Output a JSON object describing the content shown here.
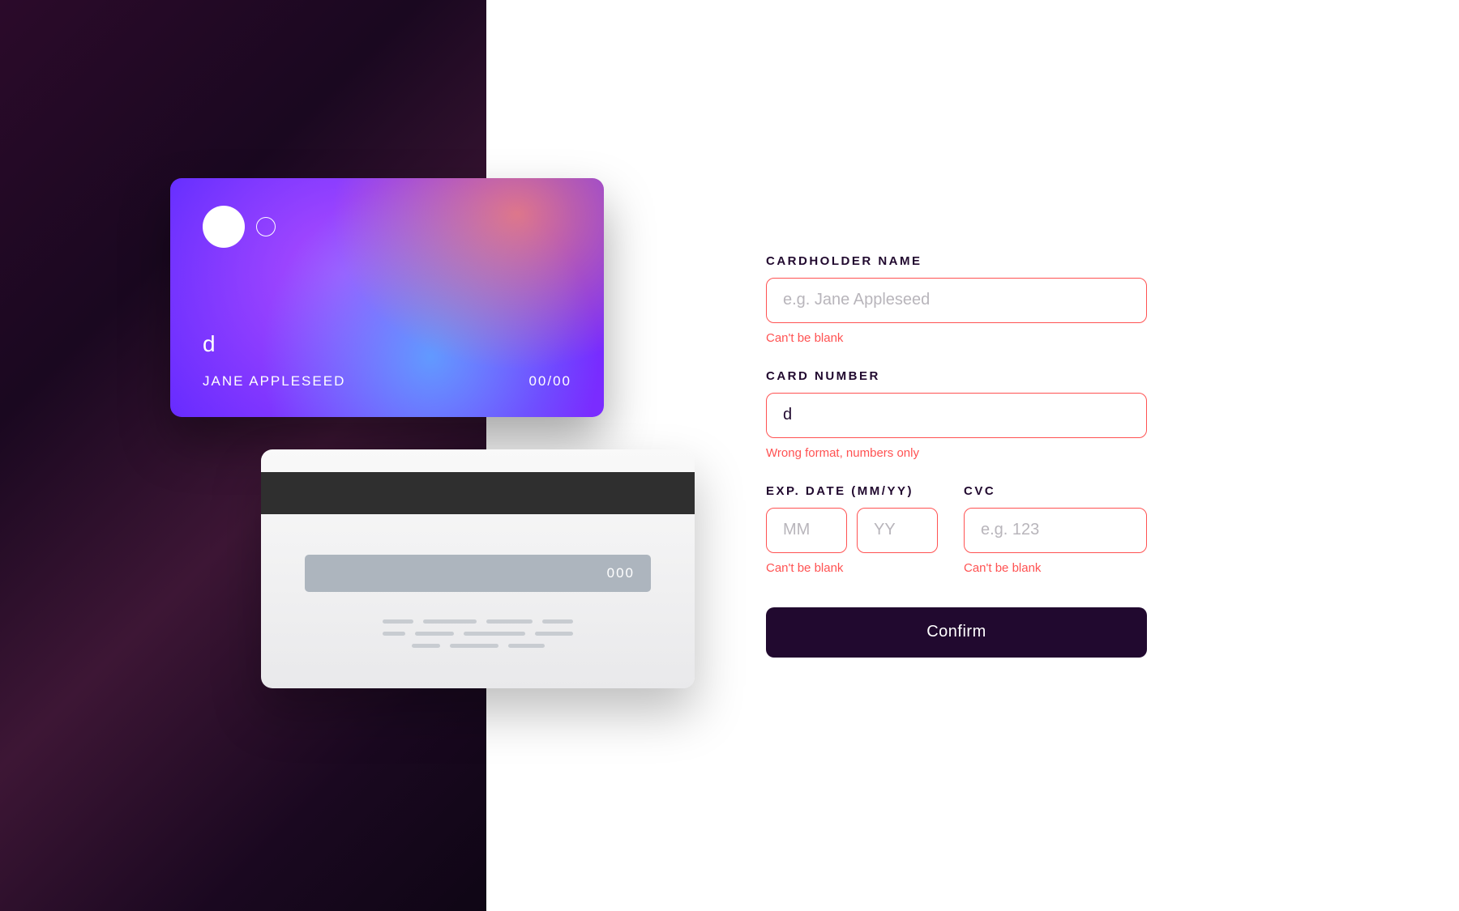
{
  "card": {
    "number": "d",
    "name": "JANE APPLESEED",
    "expiry": "00/00",
    "cvc": "000"
  },
  "form": {
    "cardholder": {
      "label": "CARDHOLDER NAME",
      "placeholder": "e.g. Jane Appleseed",
      "value": "",
      "error": "Can't be blank"
    },
    "cardnumber": {
      "label": "CARD NUMBER",
      "placeholder": "",
      "value": "d",
      "error": "Wrong format, numbers only"
    },
    "expiry": {
      "label": "EXP. DATE (MM/YY)",
      "mm_placeholder": "MM",
      "yy_placeholder": "YY",
      "mm_value": "",
      "yy_value": "",
      "error": "Can't be blank"
    },
    "cvc": {
      "label": "CVC",
      "placeholder": "e.g. 123",
      "value": "",
      "error": "Can't be blank"
    },
    "confirm_label": "Confirm"
  },
  "colors": {
    "error": "#ff5252",
    "primary": "#21092f"
  }
}
